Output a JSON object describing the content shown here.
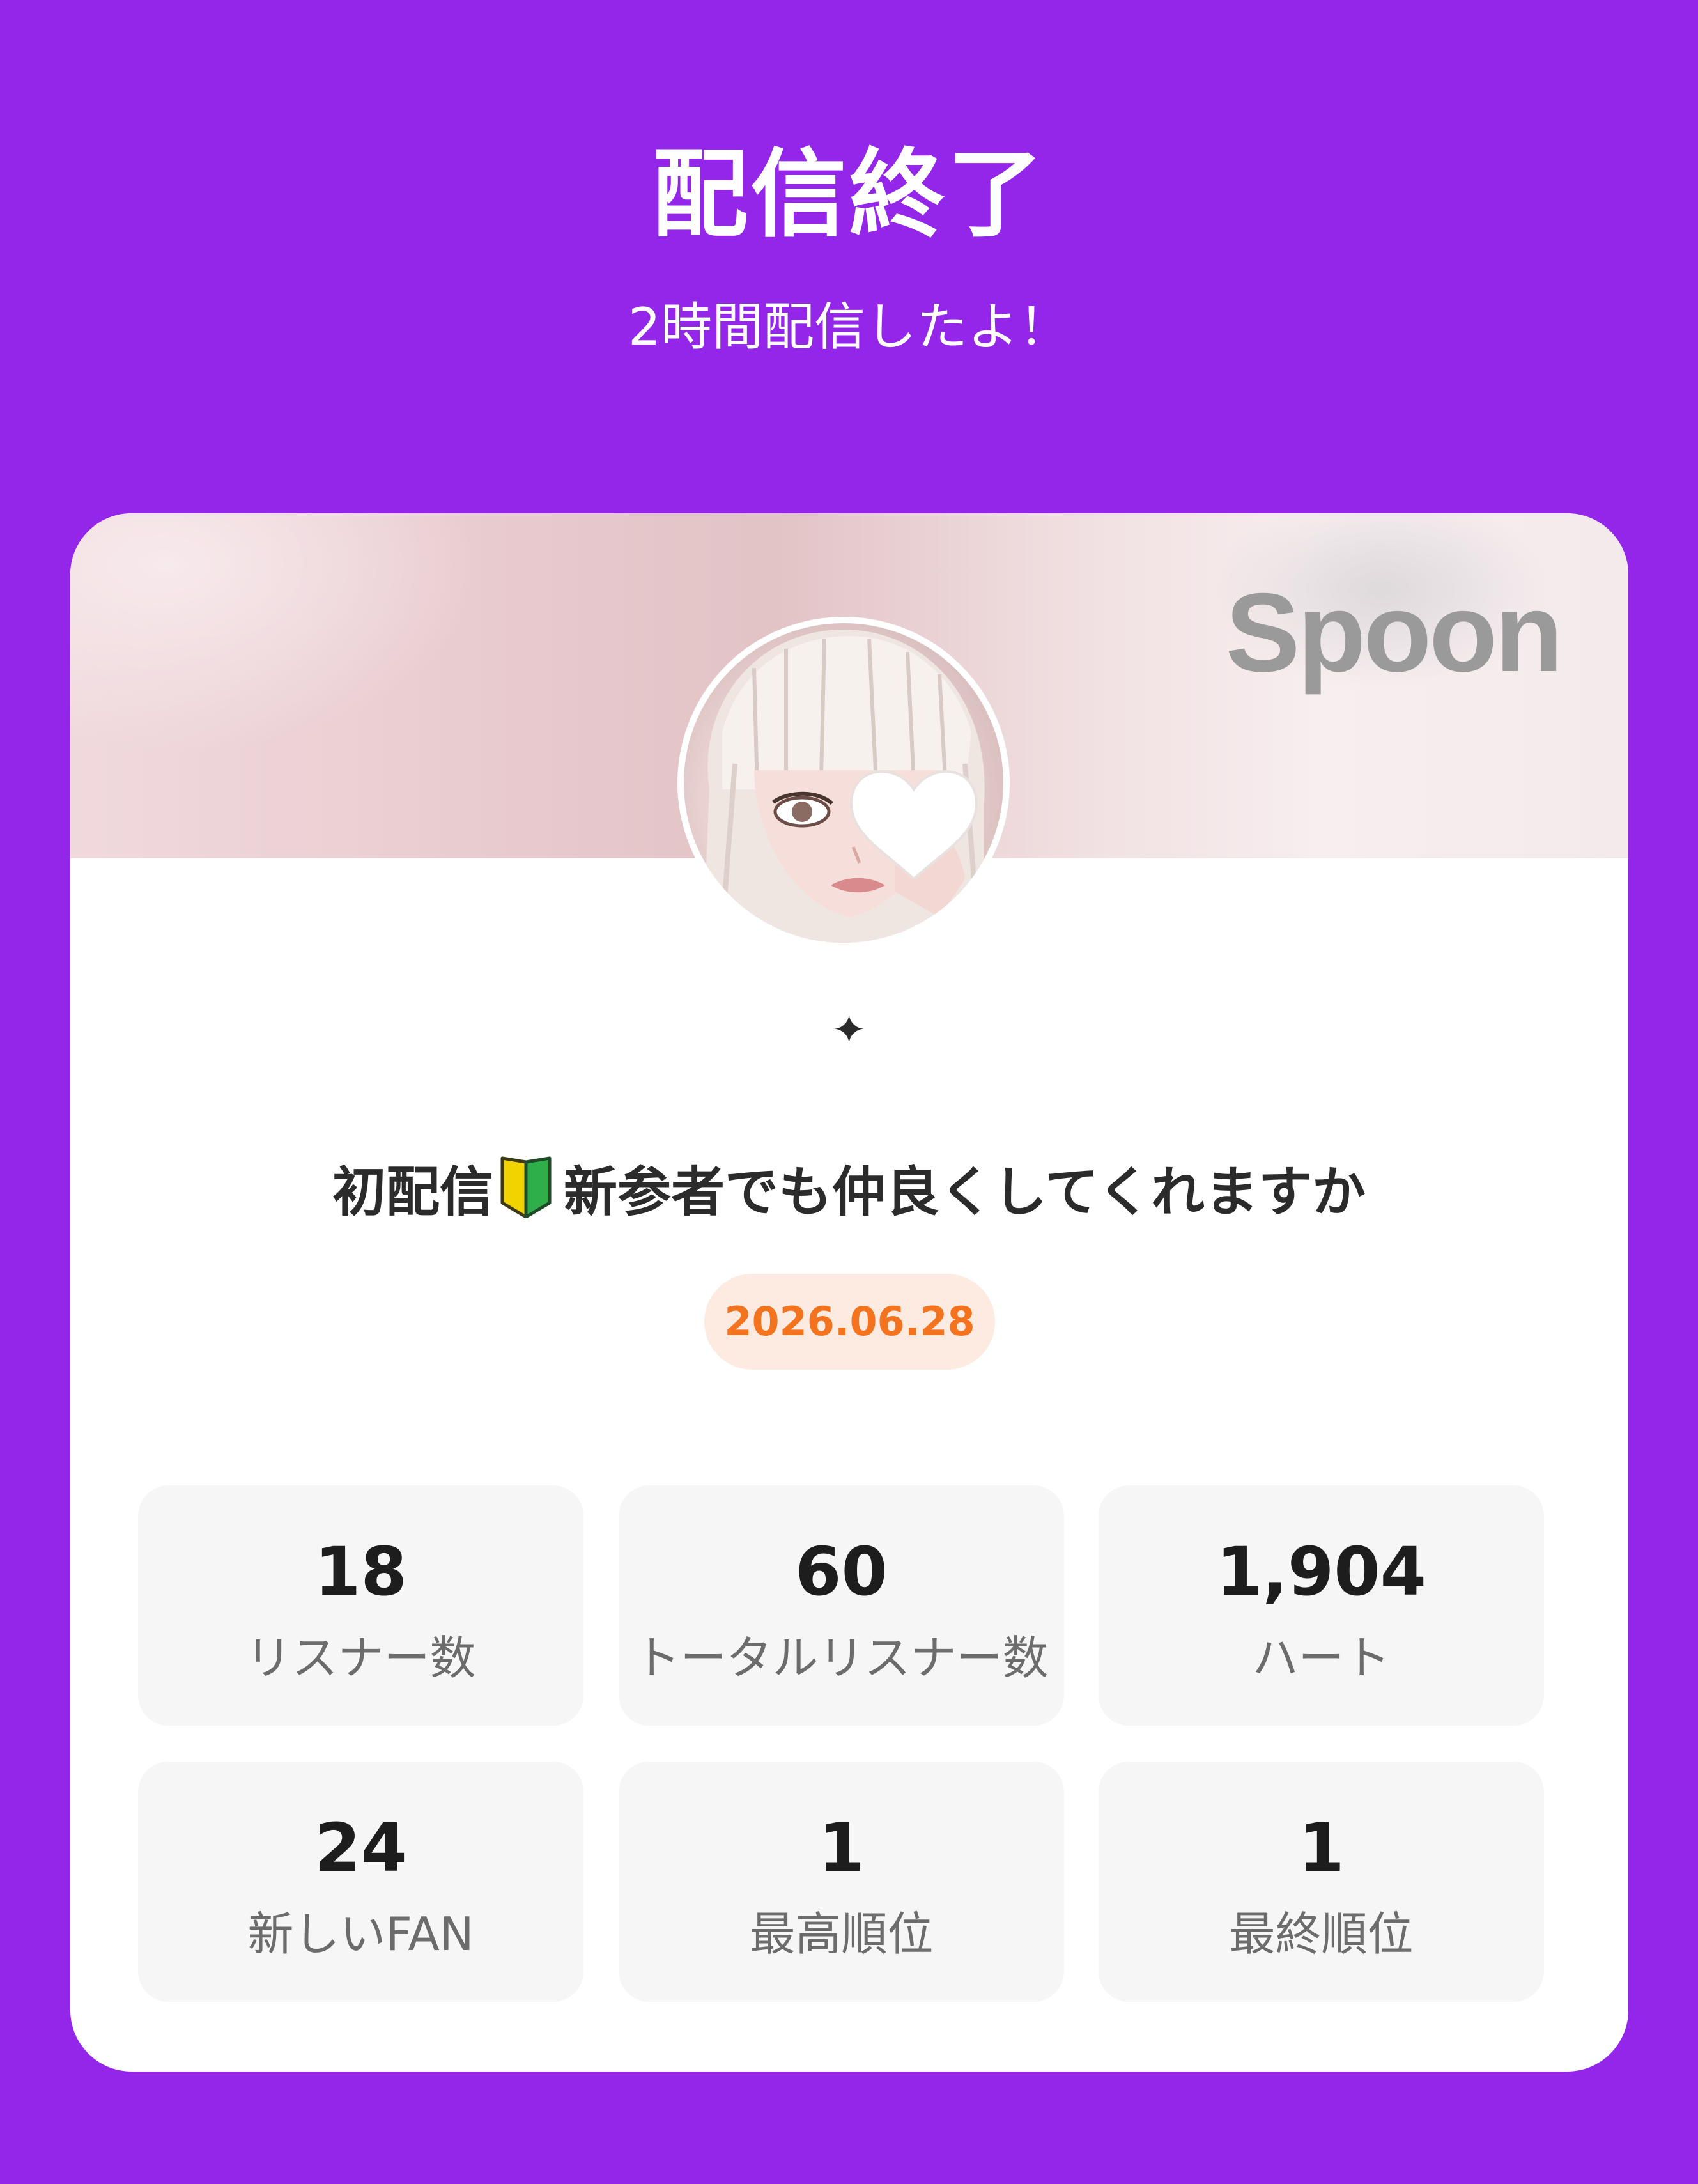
{
  "header": {
    "title": "配信終了",
    "subtitle": "2時間配信したよ！"
  },
  "card": {
    "logo": "Spoon",
    "avatar": "profile-avatar",
    "sparkle": "✦",
    "stream_title_prefix": "初配信",
    "stream_title_icon": "beginner-mark-icon",
    "stream_title_suffix": "新参者でも仲良くしてくれますか",
    "date": "2026.06.28",
    "colors": {
      "background": "#9426e9",
      "card": "#ffffff",
      "date_text": "#f4731f",
      "date_badge": "#fdeae1",
      "stat_box": "#f6f6f6"
    }
  },
  "stats": [
    {
      "value": "18",
      "label": "リスナー数"
    },
    {
      "value": "60",
      "label": "トータルリスナー数"
    },
    {
      "value": "1,904",
      "label": "ハート"
    },
    {
      "value": "24",
      "label": "新しいFAN"
    },
    {
      "value": "1",
      "label": "最高順位"
    },
    {
      "value": "1",
      "label": "最終順位"
    }
  ]
}
